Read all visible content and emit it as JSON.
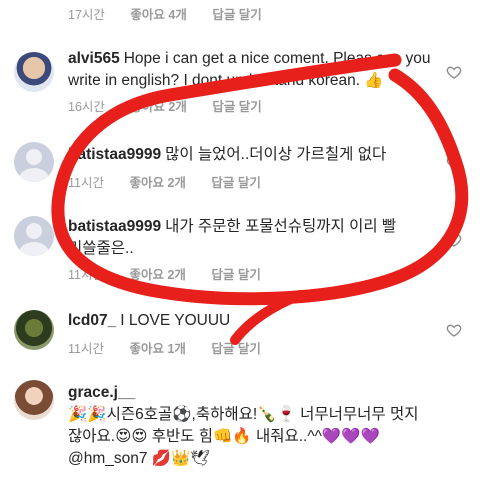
{
  "comments": [
    {
      "username": "",
      "text": "",
      "time": "17시간",
      "likes": "좋아요 4개",
      "reply": "답글 달기"
    },
    {
      "username": "alvi565",
      "text": "Hope i can get a nice coment. Pleas can you write in english? I dont understand korean. 👍",
      "time": "16시간",
      "likes": "좋아요 2개",
      "reply": "답글 달기"
    },
    {
      "username": "batistaa9999",
      "text": "많이 늘었어..더이상 가르칠게 없다",
      "time": "11시간",
      "likes": "좋아요 2개",
      "reply": "답글 달기"
    },
    {
      "username": "batistaa9999",
      "text": "내가 주문한 포물선슈팅까지 이리 빨리쓸줄은..",
      "time": "11시간",
      "likes": "좋아요 2개",
      "reply": "답글 달기"
    },
    {
      "username": "lcd07_",
      "text": "I LOVE YOUUU",
      "time": "11시간",
      "likes": "좋아요 1개",
      "reply": "답글 달기"
    },
    {
      "username": "grace.j__",
      "text": "🎉🎉시즌6호골⚽,축하해요!🍾🍷 너무너무너무 멋지잖아요.😍😍 후반도 힘👊🔥 내줘요..^^💜💜💜 @hm_son7 💋👑🕊",
      "time": "",
      "likes": "",
      "reply": ""
    }
  ],
  "icons": {
    "heart": "heart-outline-icon",
    "annotation": "red-hand-drawn-circle"
  },
  "colors": {
    "annotation": "#e8201c",
    "meta": "#9a9a9a",
    "text": "#262626"
  }
}
